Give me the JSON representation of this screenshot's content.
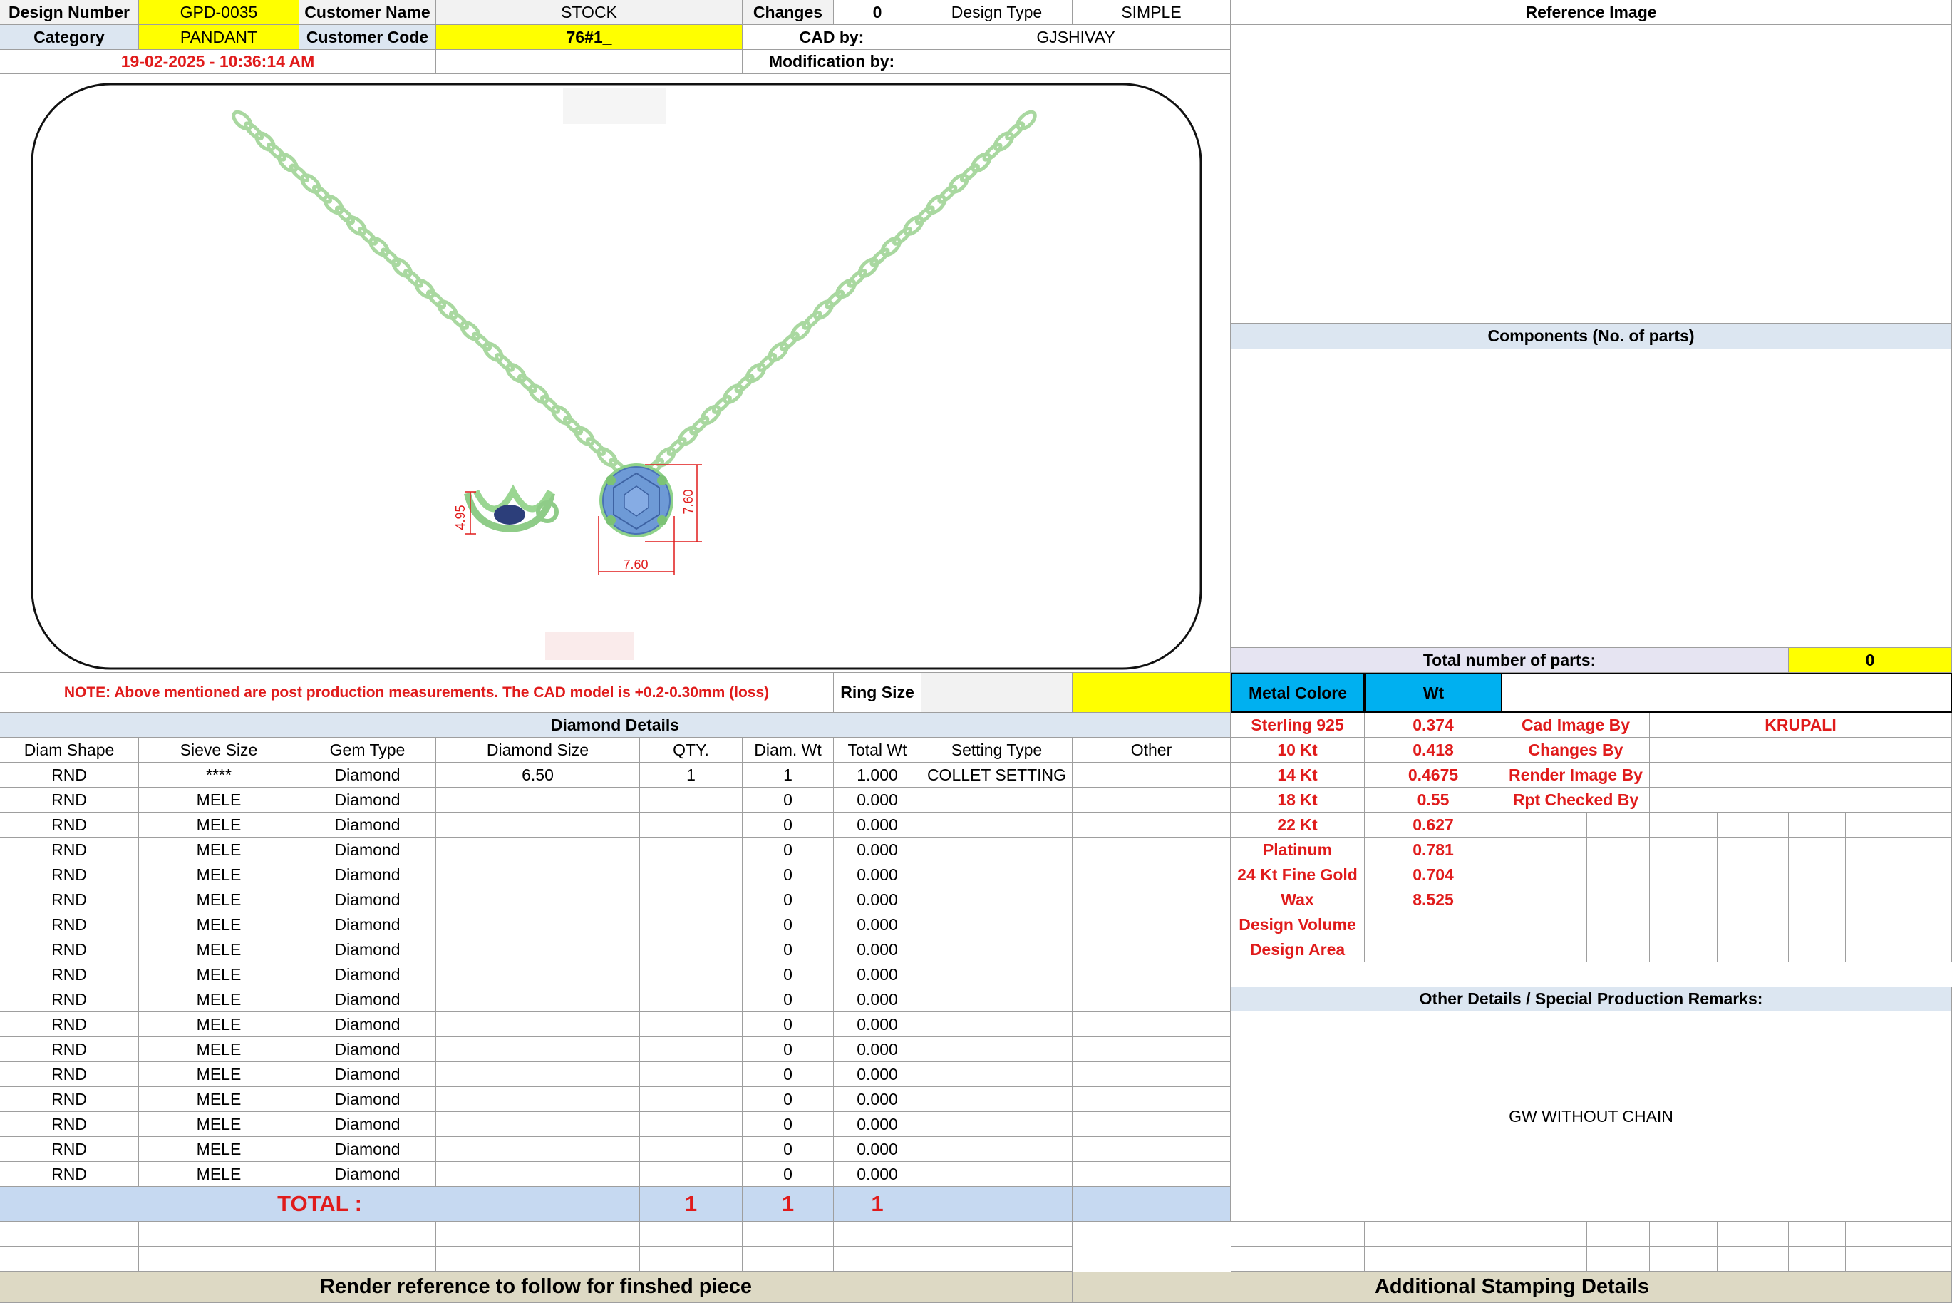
{
  "header": {
    "design_number_label": "Design Number",
    "design_number": "GPD-0035",
    "customer_name_label": "Customer Name",
    "customer_name": "STOCK",
    "changes_label": "Changes",
    "changes": "0",
    "design_type_label": "Design Type",
    "design_type": "SIMPLE",
    "category_label": "Category",
    "category": "PANDANT",
    "customer_code_label": "Customer Code",
    "customer_code": "76#1_",
    "cad_by_label": "CAD by:",
    "cad_by": "GJSHIVAY",
    "timestamp": "19-02-2025 - 10:36:14 AM",
    "modification_by_label": "Modification by:"
  },
  "drawing": {
    "dim_height": "4.95",
    "dim_side": "7.60",
    "dim_width": "7.60"
  },
  "right_panel": {
    "reference_image_label": "Reference Image",
    "components_label": "Components (No. of parts)",
    "total_parts_label": "Total number of parts:",
    "total_parts": "0"
  },
  "note": {
    "text": "NOTE: Above mentioned are post production measurements. The CAD model is +0.2-0.30mm (loss)",
    "ring_size_label": "Ring Size"
  },
  "metal": {
    "color_label": "Metal Colore",
    "wt_label": "Wt",
    "rows": [
      {
        "name": "Sterling 925",
        "wt": "0.374"
      },
      {
        "name": "10 Kt",
        "wt": "0.418"
      },
      {
        "name": "14 Kt",
        "wt": "0.4675"
      },
      {
        "name": "18 Kt",
        "wt": "0.55"
      },
      {
        "name": "22 Kt",
        "wt": "0.627"
      },
      {
        "name": "Platinum",
        "wt": "0.781"
      },
      {
        "name": "24 Kt Fine Gold",
        "wt": "0.704"
      },
      {
        "name": "Wax",
        "wt": "8.525"
      },
      {
        "name": "Design Volume",
        "wt": ""
      },
      {
        "name": "Design Area",
        "wt": ""
      }
    ],
    "roles": [
      {
        "label": "Cad Image By",
        "value": "KRUPALI"
      },
      {
        "label": "Changes By",
        "value": ""
      },
      {
        "label": "Render Image By",
        "value": ""
      },
      {
        "label": "Rpt Checked By",
        "value": ""
      }
    ]
  },
  "diamond": {
    "title": "Diamond Details",
    "columns": [
      "Diam Shape",
      "Sieve Size",
      "Gem Type",
      "Diamond Size",
      "QTY.",
      "Diam. Wt",
      "Total Wt",
      "Setting Type",
      "Other"
    ],
    "rows": [
      [
        "RND",
        "****",
        "Diamond",
        "6.50",
        "1",
        "1",
        "1.000",
        "COLLET SETTING",
        ""
      ],
      [
        "RND",
        "MELE",
        "Diamond",
        "",
        "",
        "0",
        "0.000",
        "",
        ""
      ],
      [
        "RND",
        "MELE",
        "Diamond",
        "",
        "",
        "0",
        "0.000",
        "",
        ""
      ],
      [
        "RND",
        "MELE",
        "Diamond",
        "",
        "",
        "0",
        "0.000",
        "",
        ""
      ],
      [
        "RND",
        "MELE",
        "Diamond",
        "",
        "",
        "0",
        "0.000",
        "",
        ""
      ],
      [
        "RND",
        "MELE",
        "Diamond",
        "",
        "",
        "0",
        "0.000",
        "",
        ""
      ],
      [
        "RND",
        "MELE",
        "Diamond",
        "",
        "",
        "0",
        "0.000",
        "",
        ""
      ],
      [
        "RND",
        "MELE",
        "Diamond",
        "",
        "",
        "0",
        "0.000",
        "",
        ""
      ],
      [
        "RND",
        "MELE",
        "Diamond",
        "",
        "",
        "0",
        "0.000",
        "",
        ""
      ],
      [
        "RND",
        "MELE",
        "Diamond",
        "",
        "",
        "0",
        "0.000",
        "",
        ""
      ],
      [
        "RND",
        "MELE",
        "Diamond",
        "",
        "",
        "0",
        "0.000",
        "",
        ""
      ],
      [
        "RND",
        "MELE",
        "Diamond",
        "",
        "",
        "0",
        "0.000",
        "",
        ""
      ],
      [
        "RND",
        "MELE",
        "Diamond",
        "",
        "",
        "0",
        "0.000",
        "",
        ""
      ],
      [
        "RND",
        "MELE",
        "Diamond",
        "",
        "",
        "0",
        "0.000",
        "",
        ""
      ],
      [
        "RND",
        "MELE",
        "Diamond",
        "",
        "",
        "0",
        "0.000",
        "",
        ""
      ],
      [
        "RND",
        "MELE",
        "Diamond",
        "",
        "",
        "0",
        "0.000",
        "",
        ""
      ],
      [
        "RND",
        "MELE",
        "Diamond",
        "",
        "",
        "0",
        "0.000",
        "",
        ""
      ]
    ],
    "total_label": "TOTAL :",
    "total_qty": "1",
    "total_diam_wt": "1",
    "total_wt": "1"
  },
  "remarks": {
    "title": "Other Details / Special Production Remarks:",
    "text": "GW WITHOUT CHAIN"
  },
  "footer": {
    "render_reference": "Render reference to follow for finshed piece",
    "stamping": "Additional Stamping Details"
  },
  "colors": {
    "highlight_yellow": "#ffff00",
    "header_blue": "#c6d9f1",
    "metal_cyan": "#00b0f0",
    "label_red": "#e01b1b",
    "chain_green": "#a9d8a0",
    "stone_blue": "#6e9ad6",
    "footer_tan": "#ddd9c4"
  }
}
